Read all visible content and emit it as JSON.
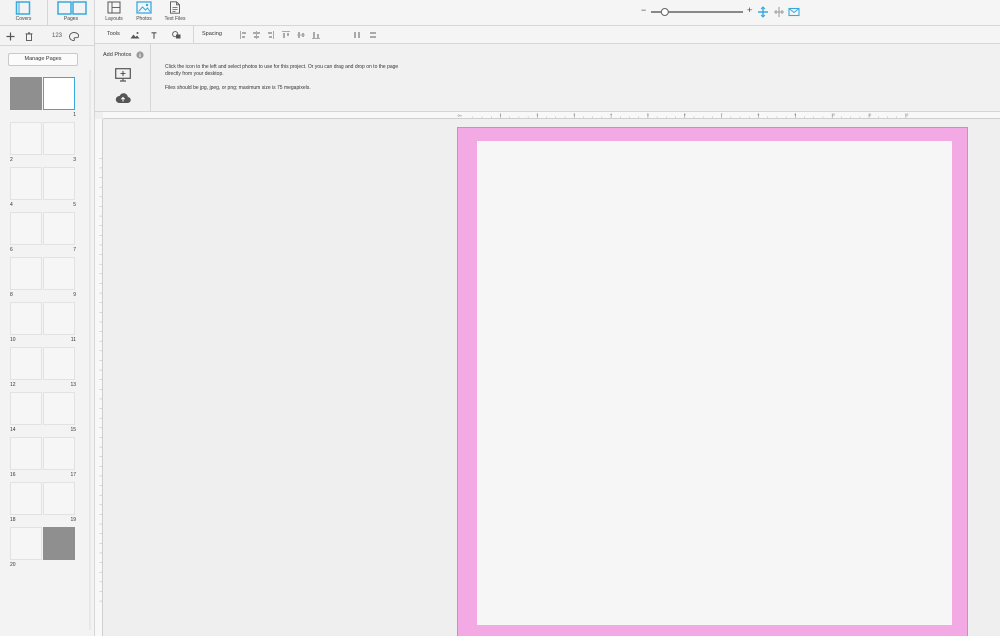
{
  "left_panel": {
    "tabs": [
      {
        "label": "Covers",
        "icon": "cover-icon"
      },
      {
        "label": "Pages",
        "icon": "pages-icon"
      }
    ],
    "tools": {
      "add_icon": "plus-icon",
      "delete_icon": "trash-icon",
      "numbering_label": "123",
      "theme_icon": "palette-icon"
    },
    "manage_pages_label": "Manage Pages",
    "spreads": [
      {
        "left": "",
        "right": "1"
      },
      {
        "left": "2",
        "right": "3"
      },
      {
        "left": "4",
        "right": "5"
      },
      {
        "left": "6",
        "right": "7"
      },
      {
        "left": "8",
        "right": "9"
      },
      {
        "left": "10",
        "right": "11"
      },
      {
        "left": "12",
        "right": "13"
      },
      {
        "left": "14",
        "right": "15"
      },
      {
        "left": "16",
        "right": "17"
      },
      {
        "left": "18",
        "right": "19"
      },
      {
        "left": "20",
        "right": ""
      }
    ]
  },
  "toolbar": {
    "items": [
      {
        "label": "Layouts",
        "icon": "layouts-icon"
      },
      {
        "label": "Photos",
        "icon": "photos-icon",
        "active": true
      },
      {
        "label": "Text Files",
        "icon": "text-file-icon"
      }
    ],
    "zoom": {
      "minus": "−",
      "plus": "+",
      "level": 0.15
    }
  },
  "tools_bar": {
    "tools_label": "Tools",
    "spacing_label": "Spacing",
    "icons": [
      "image-adjust-icon",
      "text-icon",
      "shapes-icon"
    ]
  },
  "photos_panel": {
    "title": "Add Photos",
    "info_icon": "info-icon",
    "upload_computer_icon": "computer-upload-icon",
    "upload_cloud_icon": "cloud-upload-icon",
    "message": "Click the icon to the left and select photos to use for this project. Or you can drag and drop on to the page directly from your desktop.",
    "requirements": "Files should be jpg, jpeg, or png; maximum size is 75 megapixels."
  },
  "canvas": {
    "ruler_start": "0in",
    "ruler_numbers": [
      "1",
      "2",
      "3",
      "4",
      "5",
      "6",
      "7",
      "8",
      "9",
      "10",
      "11",
      "12"
    ],
    "bleed_color": "#f2a9e4",
    "accent_color": "#36a9e1"
  }
}
